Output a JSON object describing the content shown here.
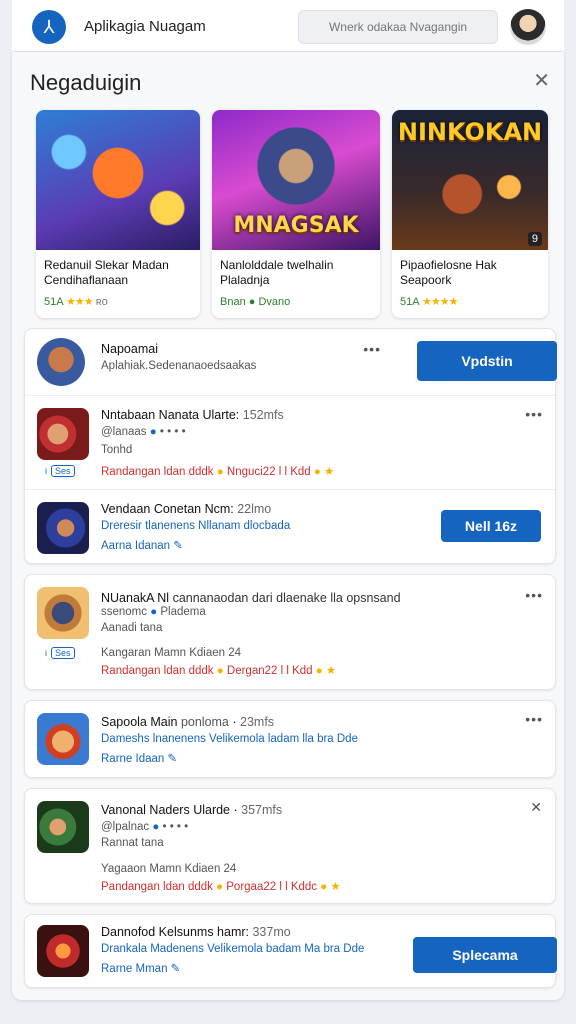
{
  "topbar": {
    "logo_glyph": "⅄",
    "title": "Aplikagia Nuagam",
    "search_placeholder": "Wnerk odakaa Nvagangin"
  },
  "panel": {
    "title": "Negaduigin",
    "close_glyph": "✕"
  },
  "featured": [
    {
      "name": "Redanuil Slekar Madan Cendihaflanaan",
      "meta_prefix": "51A",
      "stars": "★★★",
      "meta_suffix": "ʀᴏ",
      "overlay": ""
    },
    {
      "name": "Nanlolddale twelhalin Plaladnja",
      "meta_prefix": "Bnan",
      "stars": "",
      "meta_suffix": "Dvano",
      "overlay": "MNAGSAK"
    },
    {
      "name": "Pipaofielosne Hak Seapoork",
      "meta_prefix": "51A",
      "stars": "★★★★",
      "meta_suffix": "",
      "overlay": "NINKOKAN",
      "badge": "9"
    }
  ],
  "card1": {
    "top": {
      "title": "Napoamai",
      "sub": "Aplahiak.Sedenanaoedsaakas",
      "dots": "•••",
      "button": "Vpdstin"
    },
    "item1": {
      "title": "Nntabaan Nanata Ularte:",
      "time": "152mfs",
      "sub": "@lanaas",
      "line3": "Tonhd",
      "red": "Randangan ldan dddk",
      "red2": "Nnguci22 l l Kdd",
      "mini_a": "i",
      "mini_b": "Ses",
      "dots": "•••"
    },
    "item2": {
      "title": "Vendaan Conetan Ncm:",
      "time": "22lmo",
      "sub": "Dreresir tlanenens Nllanam dlocbada",
      "meta": "Aarna   Idanan",
      "button": "Nell 16z"
    }
  },
  "card2": {
    "title": "NUanakA Nl",
    "title_rest": "cannanaodan dari dlaenake lla opsnsand",
    "sub1": "ssenomc",
    "sub1b": "Pladema",
    "sub2": "Aanadi tana",
    "line": "Kangaran Mamn Kdiaen 24",
    "red": "Randangan ldan dddk",
    "red2": "Dergan22 l l Kdd",
    "mini_a": "i",
    "mini_b": "Ses",
    "dots": "•••"
  },
  "card3": {
    "title": "Sapoola Main",
    "title_rest": "ponloma",
    "time": "23mfs",
    "sub": "Dameshs lnanenens Velikemola ladam lla bra Dde",
    "meta": "Rarne   Idaan",
    "dots": "•••"
  },
  "card4": {
    "title": "Vanonal Naders Ularde",
    "time": "357mfs",
    "sub": "@lpalnac",
    "sub2": "Rannat tana",
    "line": "Yagaaon Mamn Kdiaen 24",
    "red": "Pandangan ldan dddk",
    "red2": "Porgaa22 l l Kddc",
    "close": "✕"
  },
  "card5": {
    "title": "Dannofod Kelsunms hamr:",
    "time": "337mo",
    "sub": "Drankala Madenens Velikemola badam Ma bra Dde",
    "meta": "Rarne   Mman",
    "button": "Splecama"
  }
}
